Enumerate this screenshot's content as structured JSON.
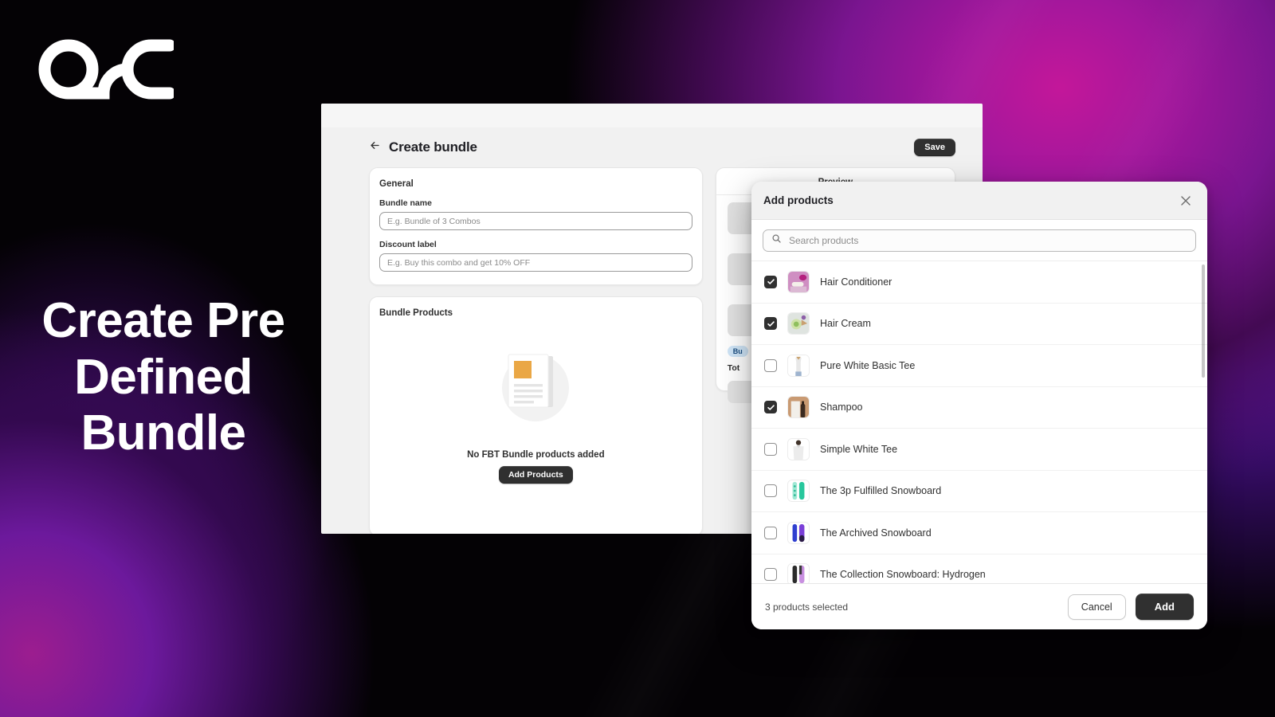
{
  "brand": {
    "logo_icon": "osc-logo",
    "headline": "Create Pre Defined Bundle"
  },
  "app": {
    "page_title": "Create bundle",
    "back_icon": "arrow-left-icon",
    "save_label": "Save",
    "general": {
      "title": "General",
      "bundle_name_label": "Bundle name",
      "bundle_name_value": "",
      "bundle_name_placeholder": "E.g. Bundle of 3 Combos",
      "discount_label_label": "Discount label",
      "discount_label_value": "",
      "discount_label_placeholder": "E.g. Buy this combo and get 10% OFF"
    },
    "bundle_products": {
      "title": "Bundle Products",
      "empty_illustration": "document-placeholder-icon",
      "empty_text": "No FBT Bundle products added",
      "add_products_label": "Add Products"
    },
    "preview": {
      "title": "Preview",
      "badge": "Bu",
      "total_label": "Tot"
    }
  },
  "modal": {
    "title": "Add products",
    "close_icon": "close-icon",
    "search": {
      "icon": "search-icon",
      "value": "",
      "placeholder": "Search products"
    },
    "products": [
      {
        "name": "Hair Conditioner",
        "checked": true,
        "thumb": "hair-conditioner-thumb"
      },
      {
        "name": "Hair Cream",
        "checked": true,
        "thumb": "hair-cream-thumb"
      },
      {
        "name": "Pure White Basic Tee",
        "checked": false,
        "thumb": "pure-white-basic-tee-thumb"
      },
      {
        "name": "Shampoo",
        "checked": true,
        "thumb": "shampoo-thumb"
      },
      {
        "name": "Simple White Tee",
        "checked": false,
        "thumb": "simple-white-tee-thumb"
      },
      {
        "name": "The 3p Fulfilled Snowboard",
        "checked": false,
        "thumb": "snowboard-teal-thumb"
      },
      {
        "name": "The Archived Snowboard",
        "checked": false,
        "thumb": "snowboard-blue-thumb"
      },
      {
        "name": "The Collection Snowboard: Hydrogen",
        "checked": false,
        "thumb": "snowboard-violet-thumb"
      }
    ],
    "footer": {
      "selected_count": "3 products selected",
      "cancel_label": "Cancel",
      "add_label": "Add"
    }
  },
  "colors": {
    "dark_button": "#303030",
    "accent_magenta": "#c3179a",
    "accent_violet": "#6d18b0",
    "badge_blue": "#cfe5f7",
    "illustration_orange": "#eaa745"
  }
}
